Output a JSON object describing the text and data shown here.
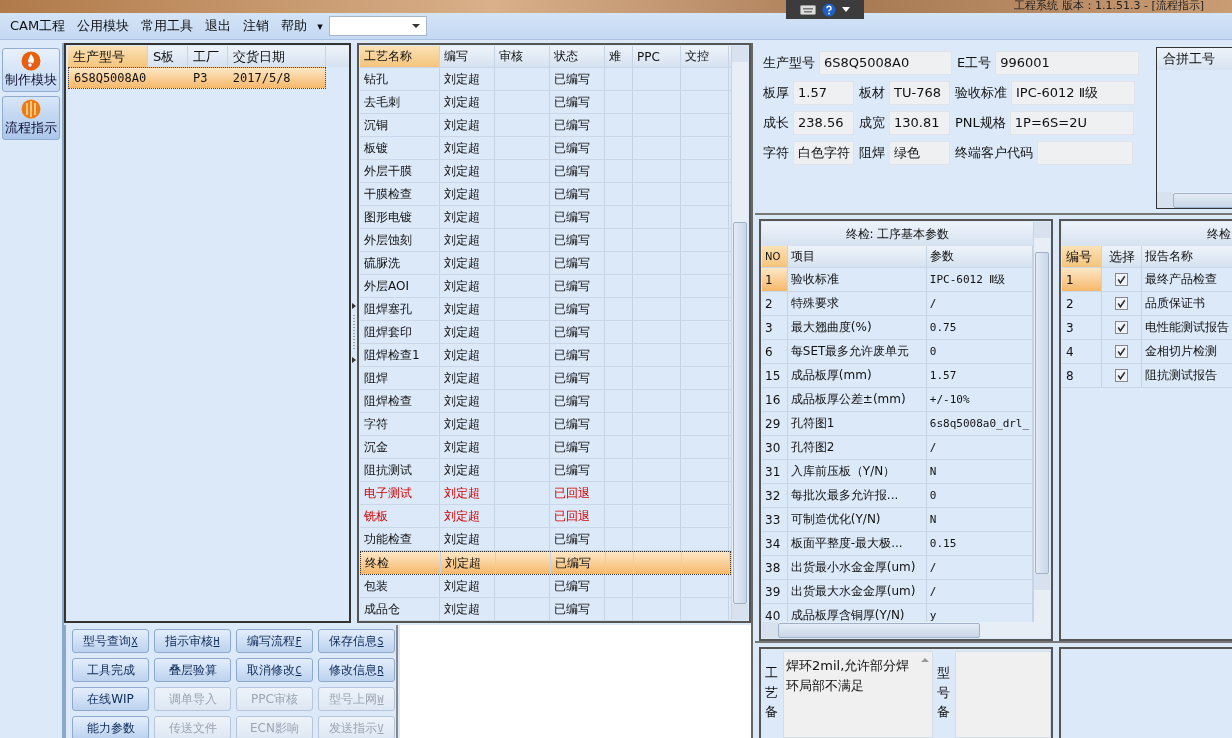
{
  "window": {
    "title": "工程系统  版本：1.1.51.3 - [流程指示]"
  },
  "menu": [
    "CAM工程",
    "公用模块",
    "常用工具",
    "退出",
    "注销",
    "帮助"
  ],
  "menu_more": "▾",
  "sidebar": [
    {
      "label": "制作模块",
      "kind": "flame",
      "selected": false
    },
    {
      "label": "流程指示",
      "kind": "globe",
      "selected": true
    }
  ],
  "jobs": {
    "columns": [
      "生产型号",
      "S板",
      "工厂",
      "交货日期"
    ],
    "rows": [
      {
        "cells": [
          "6S8Q5008A0",
          "",
          "P3",
          "2017/5/8"
        ],
        "selected": true
      }
    ]
  },
  "process": {
    "columns": [
      "工艺名称",
      "编写",
      "审核",
      "状态",
      "难",
      "PPC",
      "文控"
    ],
    "rows": [
      {
        "name": "钻孔",
        "writer": "刘定超",
        "status": "已编写",
        "returned": false,
        "selected": false
      },
      {
        "name": "去毛刺",
        "writer": "刘定超",
        "status": "已编写",
        "returned": false,
        "selected": false
      },
      {
        "name": "沉铜",
        "writer": "刘定超",
        "status": "已编写",
        "returned": false,
        "selected": false
      },
      {
        "name": "板镀",
        "writer": "刘定超",
        "status": "已编写",
        "returned": false,
        "selected": false
      },
      {
        "name": "外层干膜",
        "writer": "刘定超",
        "status": "已编写",
        "returned": false,
        "selected": false
      },
      {
        "name": "干膜检查",
        "writer": "刘定超",
        "status": "已编写",
        "returned": false,
        "selected": false
      },
      {
        "name": "图形电镀",
        "writer": "刘定超",
        "status": "已编写",
        "returned": false,
        "selected": false
      },
      {
        "name": "外层蚀刻",
        "writer": "刘定超",
        "status": "已编写",
        "returned": false,
        "selected": false
      },
      {
        "name": "硫脲洗",
        "writer": "刘定超",
        "status": "已编写",
        "returned": false,
        "selected": false
      },
      {
        "name": "外层AOI",
        "writer": "刘定超",
        "status": "已编写",
        "returned": false,
        "selected": false
      },
      {
        "name": "阻焊塞孔",
        "writer": "刘定超",
        "status": "已编写",
        "returned": false,
        "selected": false
      },
      {
        "name": "阻焊套印",
        "writer": "刘定超",
        "status": "已编写",
        "returned": false,
        "selected": false
      },
      {
        "name": "阻焊检查1",
        "writer": "刘定超",
        "status": "已编写",
        "returned": false,
        "selected": false
      },
      {
        "name": "阻焊",
        "writer": "刘定超",
        "status": "已编写",
        "returned": false,
        "selected": false
      },
      {
        "name": "阻焊检查",
        "writer": "刘定超",
        "status": "已编写",
        "returned": false,
        "selected": false
      },
      {
        "name": "字符",
        "writer": "刘定超",
        "status": "已编写",
        "returned": false,
        "selected": false
      },
      {
        "name": "沉金",
        "writer": "刘定超",
        "status": "已编写",
        "returned": false,
        "selected": false
      },
      {
        "name": "阻抗测试",
        "writer": "刘定超",
        "status": "已编写",
        "returned": false,
        "selected": false
      },
      {
        "name": "电子测试",
        "writer": "刘定超",
        "status": "已回退",
        "returned": true,
        "selected": false
      },
      {
        "name": "铣板",
        "writer": "刘定超",
        "status": "已回退",
        "returned": true,
        "selected": false
      },
      {
        "name": "功能检查",
        "writer": "刘定超",
        "status": "已编写",
        "returned": false,
        "selected": false
      },
      {
        "name": "终检",
        "writer": "刘定超",
        "status": "已编写",
        "returned": false,
        "selected": true
      },
      {
        "name": "包装",
        "writer": "刘定超",
        "status": "已编写",
        "returned": false,
        "selected": false
      },
      {
        "name": "成品仓",
        "writer": "刘定超",
        "status": "已编写",
        "returned": false,
        "selected": false
      }
    ]
  },
  "buttons": [
    {
      "label": "型号查询",
      "key": "X",
      "disabled": false
    },
    {
      "label": "指示审核",
      "key": "H",
      "disabled": false
    },
    {
      "label": "编写流程",
      "key": "F",
      "disabled": false
    },
    {
      "label": "保存信息",
      "key": "S",
      "disabled": false
    },
    {
      "label": "工具完成",
      "disabled": false
    },
    {
      "label": "叠层验算",
      "disabled": false
    },
    {
      "label": "取消修改",
      "key": "C",
      "disabled": false
    },
    {
      "label": "修改信息",
      "key": "R",
      "disabled": false
    },
    {
      "label": "在线WIP",
      "disabled": false
    },
    {
      "label": "调单导入",
      "disabled": true
    },
    {
      "label": "PPC审核",
      "disabled": true
    },
    {
      "label": "型号上网",
      "key": "W",
      "disabled": true
    },
    {
      "label": "能力参数",
      "disabled": false
    },
    {
      "label": "传送文件",
      "disabled": true
    },
    {
      "label": "ECN影响",
      "disabled": true
    },
    {
      "label": "发送指示",
      "key": "V",
      "disabled": true
    }
  ],
  "info": {
    "rows": [
      [
        {
          "label": "生产型号",
          "value": "6S8Q5008A0"
        },
        "",
        {
          "label": "E工号",
          "value": "996001"
        }
      ],
      [
        {
          "label": "板厚",
          "value": "1.57"
        },
        {
          "label": "板材",
          "value": "TU-768"
        },
        {
          "label": "验收标准",
          "value": "IPC-6012 Ⅱ级"
        }
      ],
      [
        {
          "label": "成长",
          "value": "238.56"
        },
        {
          "label": "成宽",
          "value": "130.81"
        },
        {
          "label": "PNL规格",
          "value": "1P=6S=2U"
        }
      ],
      [
        {
          "label": "字符",
          "value": "白色字符"
        },
        {
          "label": "阻焊",
          "value": "绿色"
        },
        {
          "label": "终端客户代码"
        }
      ]
    ],
    "merge_list": {
      "header": "合拼工号"
    }
  },
  "params": {
    "title": "终检: 工序基本参数",
    "columns": [
      "NO",
      "项目",
      "参数"
    ],
    "rows": [
      {
        "no": "1",
        "item": "验收标准",
        "value": "IPC-6012 Ⅱ级",
        "selected": true
      },
      {
        "no": "2",
        "item": "特殊要求",
        "value": "/",
        "selected": false
      },
      {
        "no": "3",
        "item": "最大翘曲度(%)",
        "value": "0.75",
        "selected": false
      },
      {
        "no": "6",
        "item": "每SET最多允许废单元",
        "value": "0",
        "selected": false
      },
      {
        "no": "15",
        "item": "成品板厚(mm)",
        "value": "1.57",
        "selected": false
      },
      {
        "no": "16",
        "item": "成品板厚公差±(mm)",
        "value": "+/-10%",
        "selected": false
      },
      {
        "no": "29",
        "item": "孔符图1",
        "value": "6s8q5008a0_drl_",
        "selected": false
      },
      {
        "no": "30",
        "item": "孔符图2",
        "value": "/",
        "selected": false
      },
      {
        "no": "31",
        "item": "入库前压板（Y/N）",
        "value": "N",
        "selected": false
      },
      {
        "no": "32",
        "item": "每批次最多允许报...",
        "value": "0",
        "selected": false
      },
      {
        "no": "33",
        "item": "可制造优化(Y/N)",
        "value": "N",
        "selected": false
      },
      {
        "no": "34",
        "item": "板面平整度-最大极...",
        "value": "0.15",
        "selected": false
      },
      {
        "no": "38",
        "item": "出货最小水金金厚(um)",
        "value": "/",
        "selected": false
      },
      {
        "no": "39",
        "item": "出货最大水金金厚(um)",
        "value": "/",
        "selected": false
      },
      {
        "no": "40",
        "item": "成品板厚含铜厚(Y/N)",
        "value": "y",
        "selected": false
      }
    ]
  },
  "reports": {
    "title": "终检",
    "columns": [
      "编号",
      "选择",
      "报告名称"
    ],
    "rows": [
      {
        "no": "1",
        "checked": true,
        "name": "最终产品检查",
        "selected": true
      },
      {
        "no": "2",
        "checked": true,
        "name": "品质保证书",
        "selected": false
      },
      {
        "no": "3",
        "checked": true,
        "name": "电性能测试报告",
        "selected": false
      },
      {
        "no": "4",
        "checked": true,
        "name": "金相切片检测",
        "selected": false
      },
      {
        "no": "8",
        "checked": true,
        "name": "阻抗测试报告",
        "selected": false
      }
    ]
  },
  "remarks": [
    {
      "label": "工艺备",
      "text": "焊环2mil,允许部分焊环局部不满足"
    },
    {
      "label": "型号备"
    }
  ]
}
